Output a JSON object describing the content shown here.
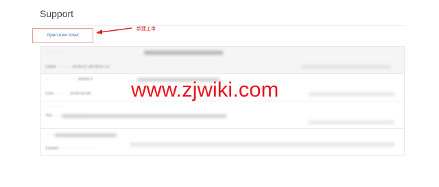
{
  "page": {
    "title": "Support"
  },
  "actions": {
    "new_ticket_label": "Open new ticket"
  },
  "annotation": {
    "text": "新建工单",
    "color": "#dd2222"
  },
  "watermark": {
    "text": "www.zjwiki.com",
    "color": "#e8141e"
  },
  "tickets": [
    {
      "subject": "· · · · · · ·",
      "meta": "Close · · · · · · 2019-07-28 09:47:27"
    },
    {
      "subject": "· · · · · · · · · · · · · renew it",
      "meta": "Clos · · · · · · 2019-05-09 · ·"
    },
    {
      "subject": "· · · · · · · ·",
      "meta": "You · · · · · · · · · · · ·"
    },
    {
      "subject": "· · · · · · · · · ·",
      "meta": "Closed · · · · · · · · · · · · · · ·"
    }
  ]
}
